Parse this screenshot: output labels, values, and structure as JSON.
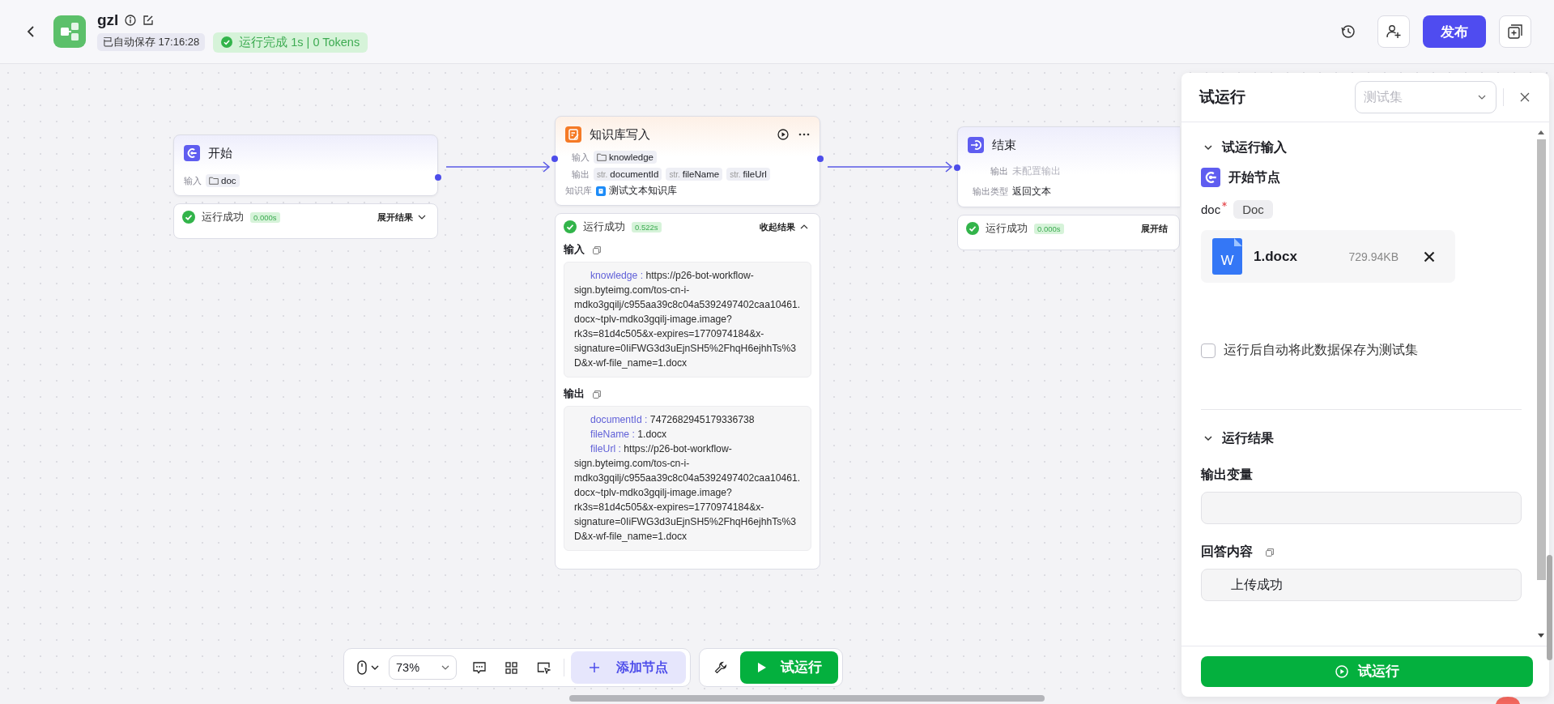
{
  "header": {
    "title": "gzl",
    "autosave": "已自动保存 17:16:28",
    "run_status": "运行完成 1s | 0 Tokens",
    "publish": "发布"
  },
  "nodes": [
    {
      "kind": "start",
      "title": "开始",
      "rows": [
        {
          "label": "输入",
          "tags": [
            {
              "kind": "folder",
              "text": "doc"
            }
          ]
        }
      ],
      "result": {
        "status": "运行成功",
        "time": "0.000s",
        "toggle": "展开结果",
        "expanded": false
      }
    },
    {
      "kind": "knowledge",
      "title": "知识库写入",
      "rows": [
        {
          "label": "输入",
          "tags": [
            {
              "kind": "folder",
              "text": "knowledge"
            }
          ]
        },
        {
          "label": "输出",
          "tags": [
            {
              "kind": "type",
              "prefix": "str.",
              "text": "documentId"
            },
            {
              "kind": "type",
              "prefix": "str.",
              "text": "fileName"
            },
            {
              "kind": "type",
              "prefix": "str.",
              "text": "fileUrl"
            }
          ]
        },
        {
          "label": "知识库",
          "tags": [
            {
              "kind": "kb",
              "text": "测试文本知识库"
            }
          ]
        }
      ],
      "result": {
        "status": "运行成功",
        "time": "0.522s",
        "toggle": "收起结果",
        "expanded": true,
        "sections": [
          {
            "title": "输入",
            "entries": [
              {
                "key": "knowledge :",
                "value": "https://p26-bot-workflow-sign.byteimg.com/tos-cn-i-mdko3gqilj/c955aa39c8c04a5392497402caa10461.docx~tplv-mdko3gqilj-image.image?rk3s=81d4c505&x-expires=1770974184&x-signature=0IiFWG3d3uEjnSH5%2FhqH6ejhhTs%3D&x-wf-file_name=1.docx"
              }
            ]
          },
          {
            "title": "输出",
            "entries": [
              {
                "key": "documentId :",
                "value": "7472682945179336738"
              },
              {
                "key": "fileName :",
                "value": "1.docx"
              },
              {
                "key": "fileUrl :",
                "value": "https://p26-bot-workflow-sign.byteimg.com/tos-cn-i-mdko3gqilj/c955aa39c8c04a5392497402caa10461.docx~tplv-mdko3gqilj-image.image?rk3s=81d4c505&x-expires=1770974184&x-signature=0IiFWG3d3uEjnSH5%2FhqH6ejhhTs%3D&x-wf-file_name=1.docx"
              }
            ]
          }
        ]
      }
    },
    {
      "kind": "end",
      "title": "结束",
      "rows": [
        {
          "label": "输出",
          "value": "未配置输出",
          "muted": true
        },
        {
          "label": "输出类型",
          "value": "返回文本",
          "muted": false
        }
      ],
      "result": {
        "status": "运行成功",
        "time": "0.000s",
        "toggle": "展开结"
      }
    }
  ],
  "toolbar": {
    "zoom": "73%",
    "add_node": "添加节点",
    "run": "试运行"
  },
  "panel": {
    "title": "试运行",
    "testset_placeholder": "测试集",
    "input_section": {
      "title": "试运行输入",
      "expanded": true,
      "node": "开始节点",
      "field": {
        "name": "doc",
        "required": true,
        "type": "Doc"
      },
      "file": {
        "icon_letter": "W",
        "name": "1.docx",
        "size": "729.94KB"
      },
      "save_option": {
        "label": "运行后自动将此数据保存为测试集",
        "checked": false
      }
    },
    "result_section": {
      "title": "运行结果",
      "expanded": true,
      "outputs": [
        {
          "label": "输出变量"
        },
        {
          "label": "回答内容",
          "value": "上传成功",
          "copyable": true
        }
      ]
    },
    "run_button": "试运行"
  }
}
